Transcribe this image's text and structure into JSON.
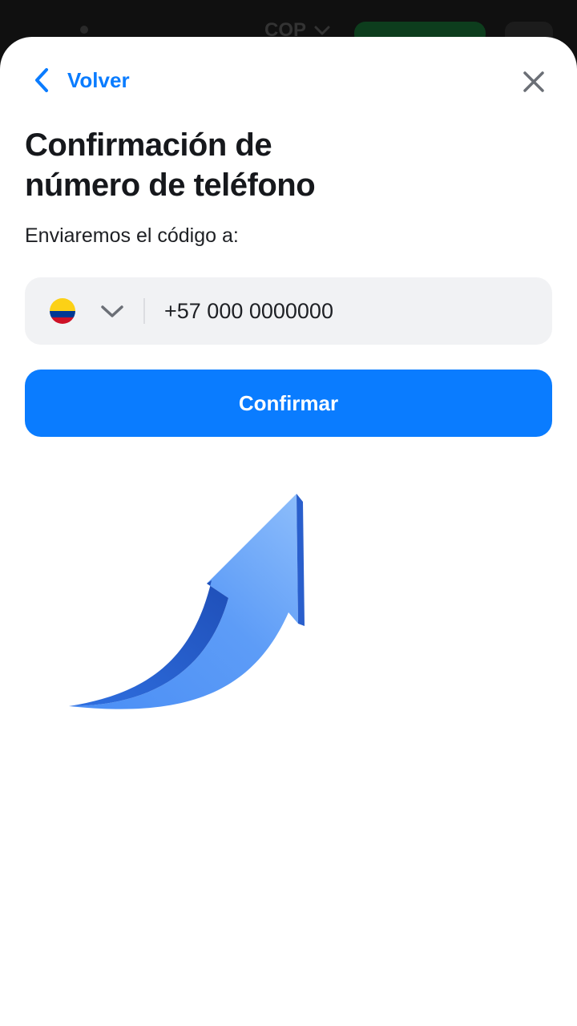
{
  "backdrop": {
    "currency": "COP"
  },
  "header": {
    "back_label": "Volver"
  },
  "title": {
    "line1": "Confirmación de",
    "line2": "número de teléfono"
  },
  "subtitle": "Enviaremos el código a:",
  "phone": {
    "country_flag": "colombia-flag",
    "value": "+57 000 0000000"
  },
  "confirm_label": "Confirmar",
  "colors": {
    "accent": "#0a7cff",
    "field_bg": "#f1f2f4",
    "text": "#16181c"
  }
}
